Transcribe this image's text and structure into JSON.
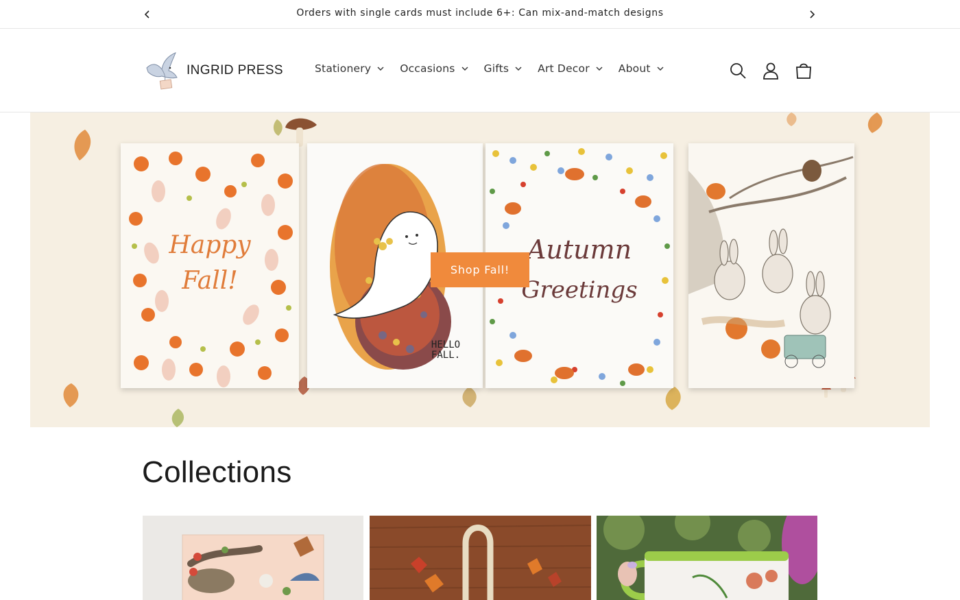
{
  "announcement": {
    "text": "Orders with single cards must include 6+: Can mix-and-match designs",
    "prev_icon": "chevron-left-icon",
    "next_icon": "chevron-right-icon"
  },
  "header": {
    "brand": "INGRID PRESS",
    "nav": [
      {
        "label": "Stationery"
      },
      {
        "label": "Occasions"
      },
      {
        "label": "Gifts"
      },
      {
        "label": "Art Decor"
      },
      {
        "label": "About"
      }
    ],
    "icons": [
      "search-icon",
      "account-icon",
      "cart-icon"
    ]
  },
  "hero": {
    "button_label": "Shop Fall!",
    "cards": [
      {
        "lettering": [
          "Happy",
          "Fall!"
        ]
      },
      {
        "lettering": [
          "HELLO",
          "FALL."
        ]
      },
      {
        "lettering": [
          "Autumn",
          "Greetings"
        ]
      },
      {
        "lettering": []
      }
    ],
    "accent_color": "#f08a3c"
  },
  "collections": {
    "title": "Collections",
    "items": [
      {
        "image": "botanical-animal-card"
      },
      {
        "image": "tote-bag-on-wood"
      },
      {
        "image": "illustrated-mug"
      }
    ]
  }
}
